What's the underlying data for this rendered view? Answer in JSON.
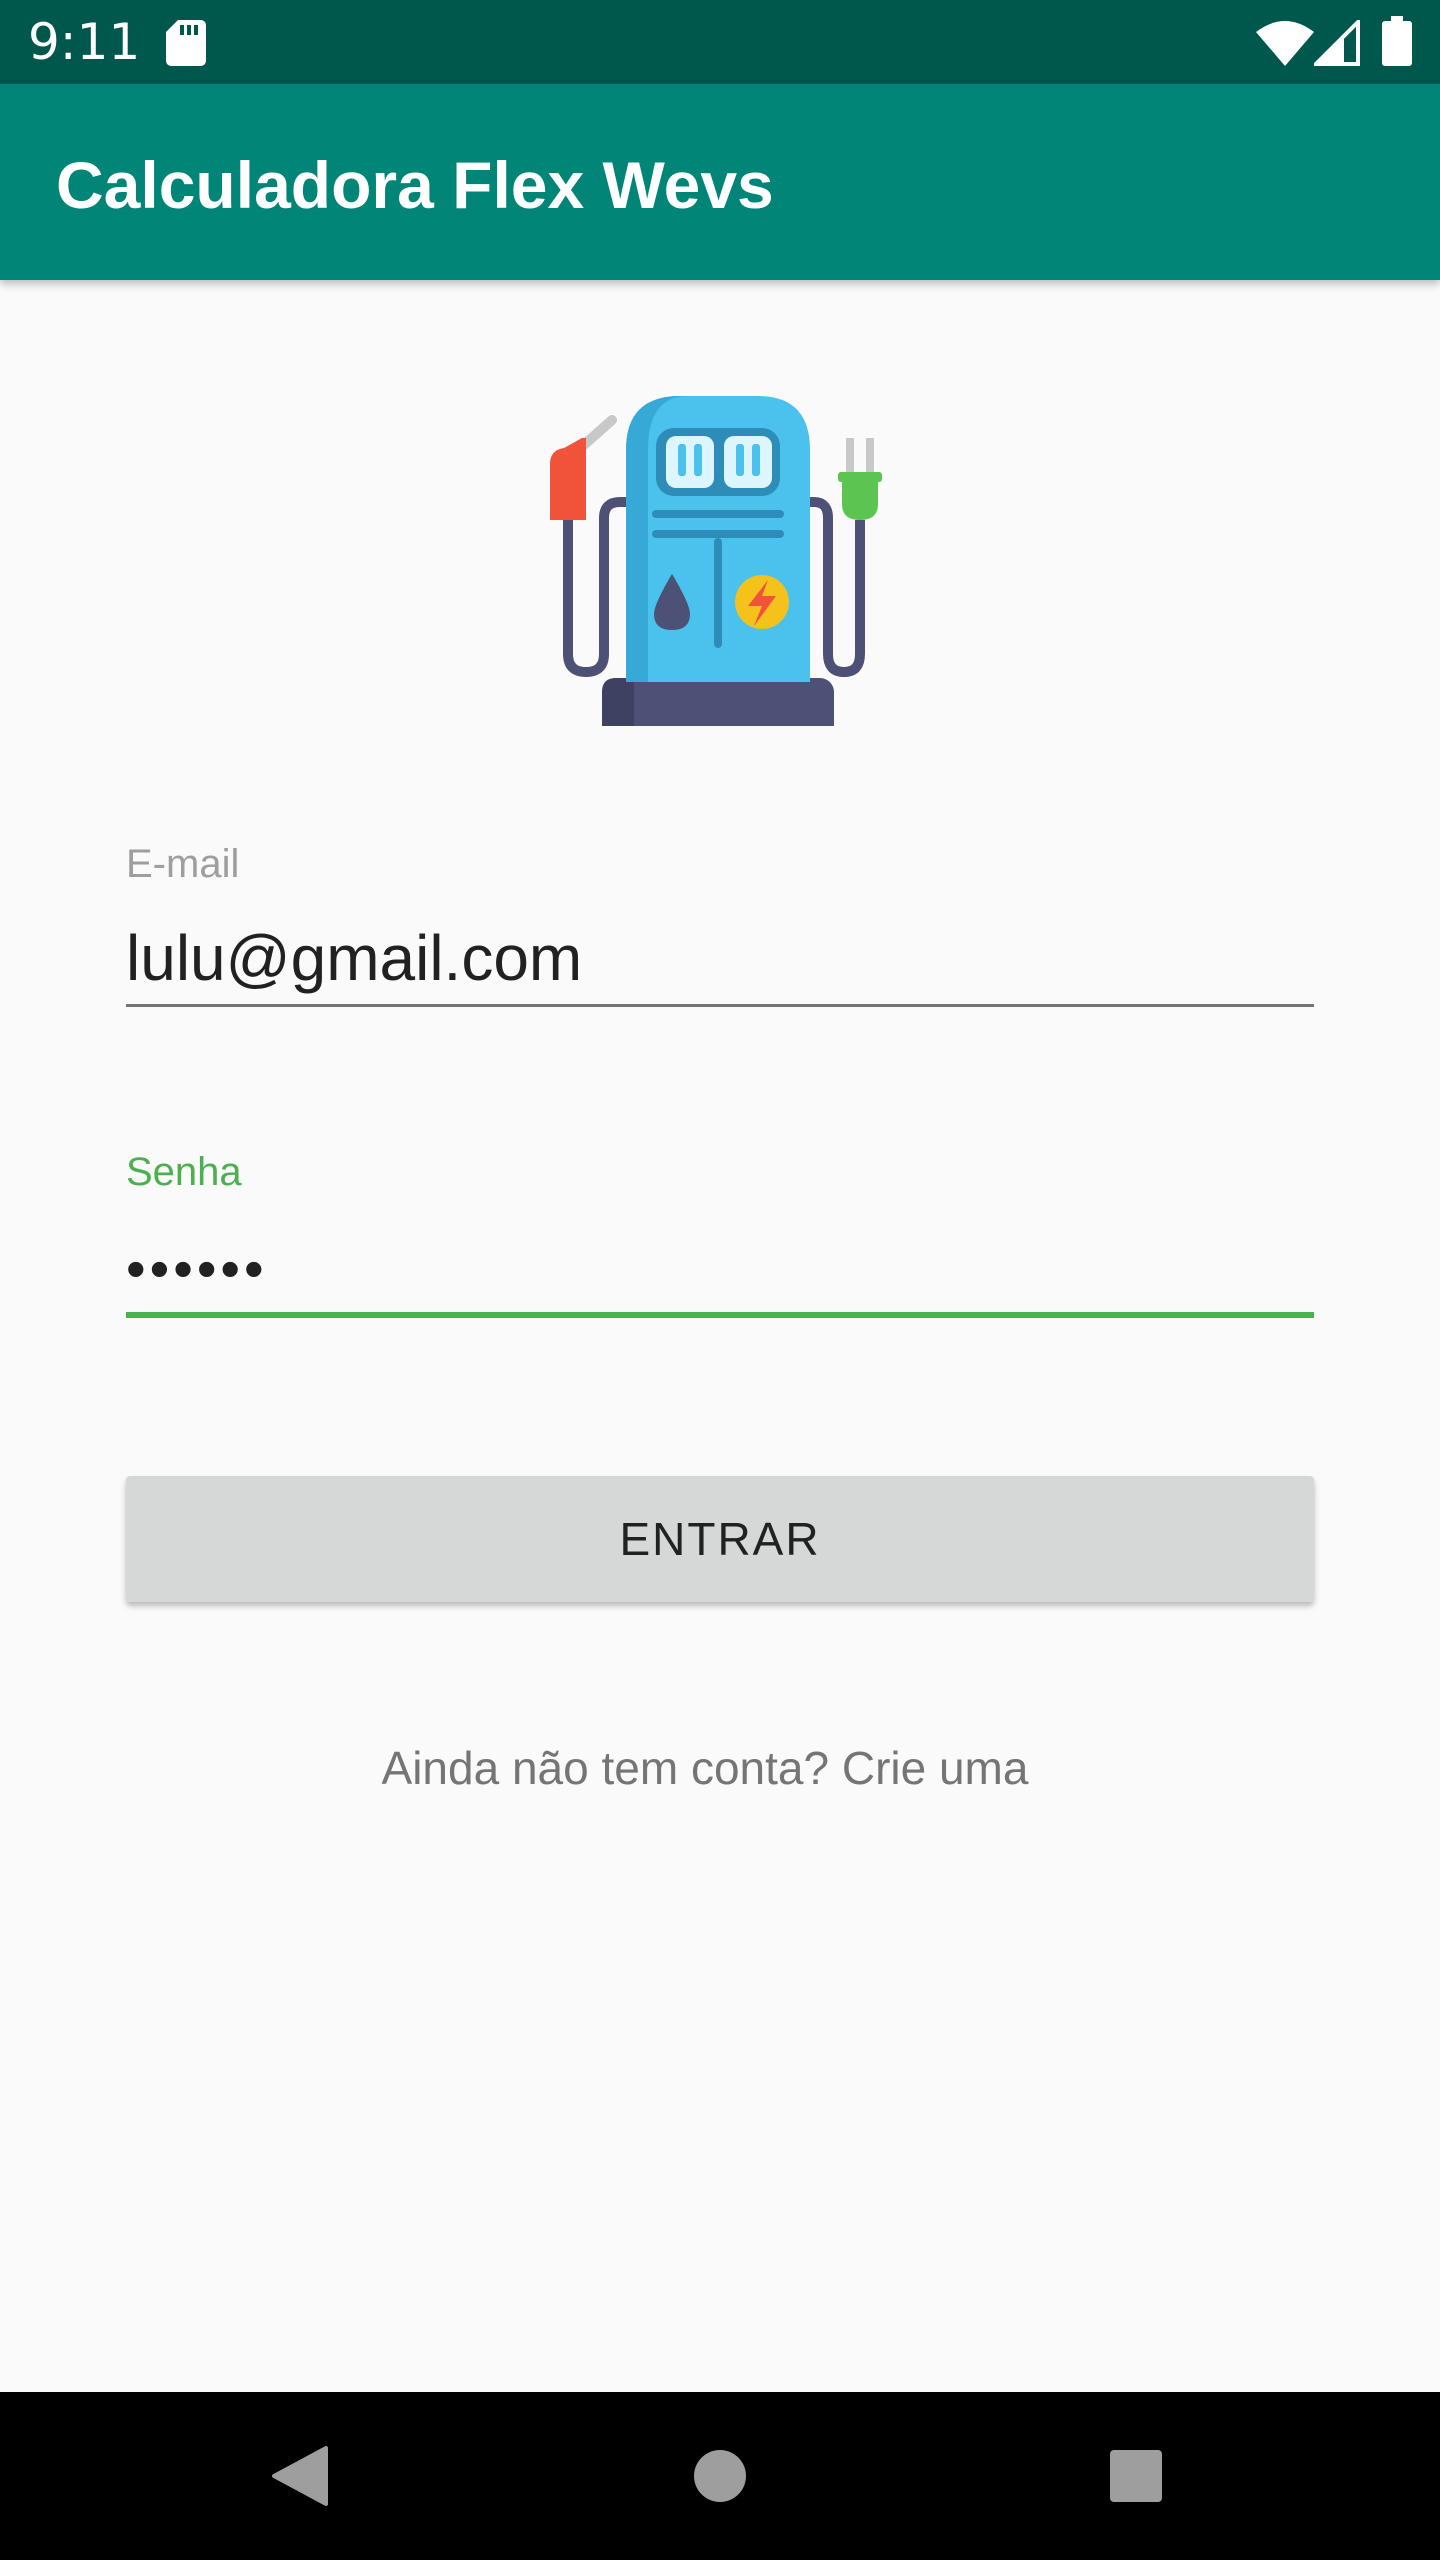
{
  "status_bar": {
    "time": "9:11",
    "icons": [
      "sd-card-icon",
      "wifi-icon",
      "signal-icon",
      "battery-icon"
    ],
    "background": "#00574B"
  },
  "app_bar": {
    "title": "Calculadora Flex Wevs",
    "background": "#008577"
  },
  "logo": {
    "icon": "fuel-pump-ev-charger-icon"
  },
  "form": {
    "email": {
      "label": "E-mail",
      "value": "lulu@gmail.com"
    },
    "password": {
      "label": "Senha",
      "value": "••••••",
      "focused": true,
      "accent": "#4CAF50"
    },
    "submit_label": "ENTRAR",
    "signup_link": "Ainda não tem conta? Crie uma"
  },
  "nav_bar": {
    "icons": [
      "back-icon",
      "home-icon",
      "recents-icon"
    ]
  }
}
